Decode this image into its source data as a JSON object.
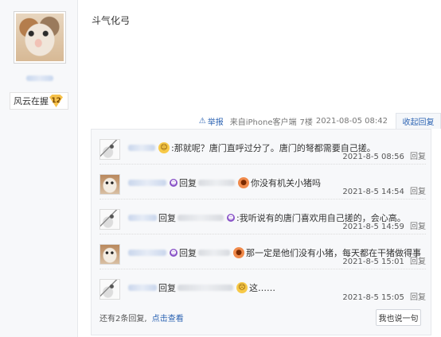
{
  "author": {
    "level_name": "风云在握",
    "level_number": "12"
  },
  "post": {
    "content": "斗气化弓",
    "meta": {
      "report_label": "举报",
      "source": "来自iPhone客户端",
      "floor": "7楼",
      "datetime": "2021-08-05 08:42",
      "collapse_label": "收起回复"
    }
  },
  "replies": [
    {
      "avatar": "sketch-avatar",
      "text": ":那就呢？唐门直呼过分了。唐门的弩都需要自己搓。",
      "emoji": "laughing-face",
      "time": "2021-8-5 08:56",
      "reply_label": "回复"
    },
    {
      "avatar": "cat-avatar",
      "prefix": "回复",
      "text": "你没有机关小猪吗",
      "emoji": "tomato-face",
      "time": "2021-8-5 14:54",
      "reply_label": "回复"
    },
    {
      "avatar": "sketch-avatar",
      "prefix": "回复",
      "text": ":我听说有的唐门喜欢用自己搓的，会心高。",
      "emoji": "devil-face",
      "time": "2021-8-5 14:59",
      "reply_label": "回复"
    },
    {
      "avatar": "cat-avatar",
      "prefix": "回复",
      "text": "那一定是他们没有小猪，每天都在干猪做得事",
      "emoji": "tomato-face",
      "time": "2021-8-5 15:01",
      "reply_label": "回复"
    },
    {
      "avatar": "sketch-avatar",
      "prefix": "回复",
      "text": "这……",
      "emoji": "sweat-face",
      "time": "2021-8-5 15:05",
      "reply_label": "回复"
    }
  ],
  "footer": {
    "more_text": "还有2条回复,",
    "view_link": "点击查看",
    "say_button": "我也说一句"
  },
  "colors": {
    "link_blue": "#2d64b3",
    "panel_bg": "#f7f8fa",
    "badge_gold": "#f6c14a"
  }
}
